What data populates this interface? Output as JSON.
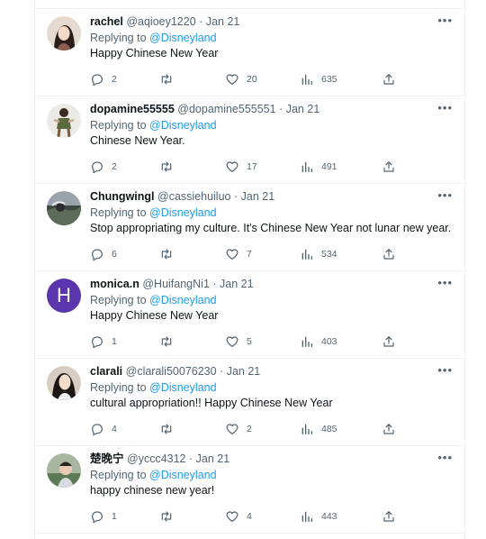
{
  "tweets": [
    {
      "name": "rachel",
      "handle": "@aqioey1220",
      "sep": "·",
      "date": "Jan 21",
      "replying_prefix": "Replying to ",
      "replying_to": "@Disneyland",
      "text": "Happy Chinese New Year",
      "replies": "2",
      "retweets": "",
      "likes": "20",
      "views": "635",
      "avatar": "photo-portrait"
    },
    {
      "name": "dopamine55555",
      "handle": "@dopamine555551",
      "sep": "·",
      "date": "Jan 21",
      "replying_prefix": "Replying to ",
      "replying_to": "@Disneyland",
      "text": "Chinese New Year.",
      "replies": "2",
      "retweets": "",
      "likes": "17",
      "views": "491",
      "avatar": "photo-figure"
    },
    {
      "name": "Chungwingl",
      "handle": "@cassiehuiluo",
      "sep": "·",
      "date": "Jan 21",
      "replying_prefix": "Replying to ",
      "replying_to": "@Disneyland",
      "text": "Stop appropriating my culture. It's Chinese New Year not lunar new year.",
      "replies": "6",
      "retweets": "",
      "likes": "7",
      "views": "534",
      "avatar": "photo-landscape"
    },
    {
      "name": "monica.n",
      "handle": "@HuifangNi1",
      "sep": "·",
      "date": "Jan 21",
      "replying_prefix": "Replying to ",
      "replying_to": "@Disneyland",
      "text": "Happy Chinese New Year",
      "replies": "1",
      "retweets": "",
      "likes": "5",
      "views": "403",
      "avatar": "letter",
      "avatar_letter": "H"
    },
    {
      "name": "clarali",
      "handle": "@clarali50076230",
      "sep": "·",
      "date": "Jan 21",
      "replying_prefix": "Replying to ",
      "replying_to": "@Disneyland",
      "text": "cultural appropriation!! Happy Chinese New Year",
      "replies": "4",
      "retweets": "",
      "likes": "2",
      "views": "485",
      "avatar": "photo-portrait-dark"
    },
    {
      "name": "楚晚宁",
      "handle": "@yccc4312",
      "sep": "·",
      "date": "Jan 21",
      "replying_prefix": "Replying to ",
      "replying_to": "@Disneyland",
      "text": "happy chinese new year!",
      "replies": "1",
      "retweets": "",
      "likes": "4",
      "views": "443",
      "avatar": "photo-outdoor"
    }
  ],
  "icons": {
    "more": "more-icon",
    "reply": "reply-icon",
    "retweet": "retweet-icon",
    "like": "like-icon",
    "views": "views-icon",
    "share": "share-icon"
  },
  "colors": {
    "accent": "#1d9bf0",
    "muted": "#536471",
    "text": "#0f1419",
    "letter_avatar": "#5b35ad"
  }
}
